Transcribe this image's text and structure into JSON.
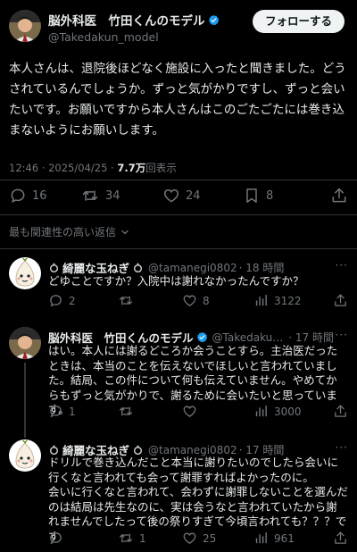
{
  "colors": {
    "background": "#000000",
    "text": "#e7e9ea",
    "muted": "#71767b",
    "verified": "#1d9bf0",
    "divider": "#2f3336"
  },
  "post": {
    "author_name": "脳外科医　竹田くんのモデル",
    "author_handle": "@Takedakun_model",
    "follow_label": "フォローする",
    "text": "本人さんは、退院後ほどなく施設に入ったと聞きました。どうされているんでしょうか。ずっと気がかりですし、ずっと会いたいです。お願いですから本人さんはこのごたごたには巻き込まないようにお願いします。",
    "time": "12:46 · 2025/04/25 · ",
    "views": "7.7万",
    "views_label": "回表示",
    "replies": "16",
    "reposts": "34",
    "likes": "24",
    "bookmarks": "8"
  },
  "sort_label": "最も関連性の高い返信",
  "replies": [
    {
      "name_prefix": "",
      "name": "綺麗な玉ねぎ",
      "handle": "@tamanegi0802",
      "time": "· 18 時間",
      "text": "どゆことですか？入院中は謝れなかったんですか？",
      "replies": "2",
      "reposts": "",
      "likes": "8",
      "views": "3122",
      "icon": "tamanegi"
    },
    {
      "name_prefix": "",
      "name": "脳外科医　竹田くんのモデル",
      "handle": "@Takedakun_...",
      "time": "· 17 時間",
      "text": "はい。本人には謝るどころか会うことすら。主治医だったときは、本当のことを伝えないでほしいと言われていました。結局、この件について何も伝えていません。やめてからもずっと気がかりで、謝るために会いたいと思っています。",
      "replies": "1",
      "reposts": "",
      "likes": "",
      "views": "3000",
      "icon": "doctor"
    },
    {
      "name_prefix": "",
      "name": "綺麗な玉ねぎ",
      "handle": "@tamanegi0802",
      "time": "· 17 時間",
      "text": "ドリルで巻き込んだこと本当に謝りたいのでしたら会いに行くなと言われても会って謝罪すればよかったのに。\n会いに行くなと言われて、会わずに謝罪しないことを選んだのは結局は先生なのに、実は会うなと言われていたから謝れませんでしたって後の祭りすぎて今頃言われても？？？です",
      "replies": "",
      "reposts": "1",
      "likes": "25",
      "views": "961",
      "icon": "tamanegi"
    }
  ]
}
